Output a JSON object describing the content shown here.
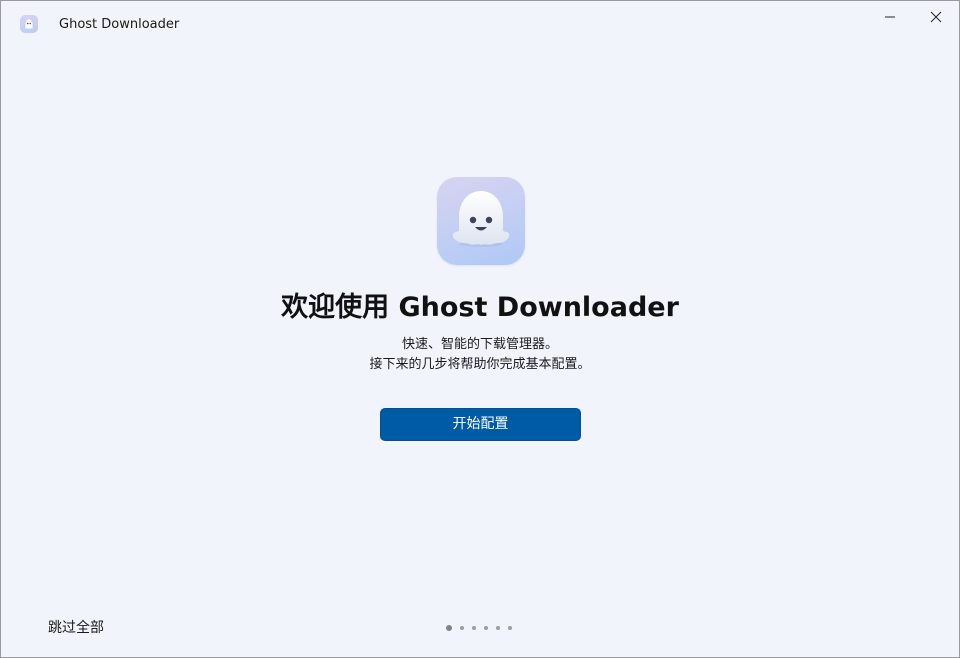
{
  "window": {
    "title": "Ghost Downloader",
    "icon": "ghost-icon",
    "controls": [
      "minimize-icon",
      "close-icon"
    ]
  },
  "welcome": {
    "logo_icon": "ghost-icon",
    "title": "欢迎使用 Ghost Downloader",
    "subtitle_line1": "快速、智能的下载管理器。",
    "subtitle_line2": "接下来的几步将帮助你完成基本配置。",
    "start_button_label": "开始配置"
  },
  "footer": {
    "skip_label": "跳过全部",
    "pager": {
      "total_steps": 6,
      "current_step": 1
    }
  },
  "colors": {
    "window_background": "#f1f5fb",
    "accent": "#005ba6",
    "text": "#111111"
  }
}
